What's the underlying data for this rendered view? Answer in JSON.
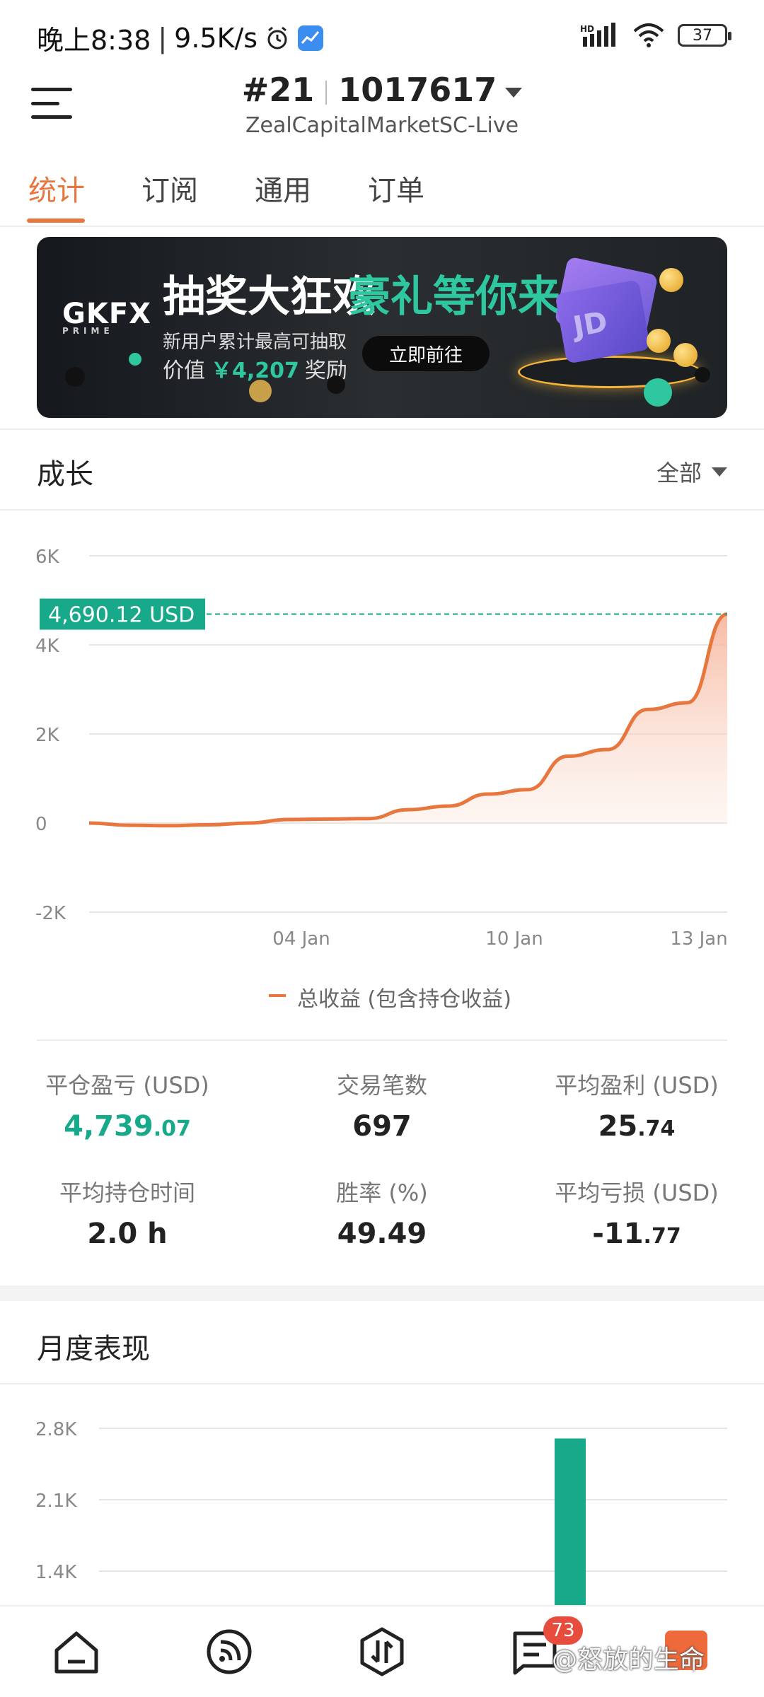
{
  "status_bar": {
    "time": "晚上8:38",
    "speed": "9.5K/s",
    "network": "HD",
    "battery": "37"
  },
  "header": {
    "account_index": "#21",
    "account_number": "1017617",
    "server": "ZealCapitalMarketSC-Live"
  },
  "tabs": [
    {
      "label": "统计",
      "active": true
    },
    {
      "label": "订阅",
      "active": false
    },
    {
      "label": "通用",
      "active": false
    },
    {
      "label": "订单",
      "active": false
    }
  ],
  "banner": {
    "logo": "GKFX",
    "logo_sub": "PRIME",
    "title_white": "抽奖大狂欢",
    "title_green": "豪礼等你来",
    "subtitle": "新用户累计最高可抽取",
    "value_prefix": "价值",
    "value_amount": "￥4,207",
    "value_suffix": "奖励",
    "button": "立即前往"
  },
  "growth": {
    "title": "成长",
    "filter": "全部",
    "current_label": "4,690.12 USD",
    "legend": "总收益 (包含持仓收益)",
    "chart_data": {
      "type": "area",
      "y_ticks": [
        "6K",
        "4K",
        "2K",
        "0",
        "-2K"
      ],
      "ylim": [
        -2000,
        6000
      ],
      "x_ticks": [
        "04 Jan",
        "10 Jan",
        "13 Jan"
      ],
      "series": [
        {
          "name": "总收益 (包含持仓收益)",
          "color": "#e8773f",
          "values": [
            0,
            -50,
            -60,
            -40,
            0,
            80,
            90,
            100,
            300,
            380,
            650,
            750,
            1500,
            1650,
            2550,
            2700,
            4690.12
          ]
        }
      ],
      "grid": true,
      "current_value": 4690.12
    }
  },
  "stats": [
    {
      "label": "平仓盈亏 (USD)",
      "int": "4,739",
      "dec": ".07",
      "teal": true
    },
    {
      "label": "交易笔数",
      "int": "697",
      "dec": "",
      "teal": false
    },
    {
      "label": "平均盈利 (USD)",
      "int": "25",
      "dec": ".74",
      "teal": false
    },
    {
      "label": "平均持仓时间",
      "int": "2.0 h",
      "dec": "",
      "teal": false
    },
    {
      "label": "胜率 (%)",
      "int": "49.49",
      "dec": "",
      "teal": false
    },
    {
      "label": "平均亏损 (USD)",
      "int": "-11",
      "dec": ".77",
      "teal": false
    }
  ],
  "monthly": {
    "title": "月度表现",
    "chart_data": {
      "type": "bar",
      "y_ticks": [
        "2.8K",
        "2.1K",
        "1.4K"
      ],
      "bar_value": 2700,
      "color": "#17a98a"
    }
  },
  "bottom_nav": {
    "badge": "73",
    "watermark": "@怒放的生命",
    "items": [
      "home-icon",
      "feed-icon",
      "trade-icon",
      "orders-icon",
      "profile-icon"
    ]
  },
  "colors": {
    "accent": "#e8773f",
    "teal": "#17a98a",
    "badge": "#e84c3d"
  }
}
